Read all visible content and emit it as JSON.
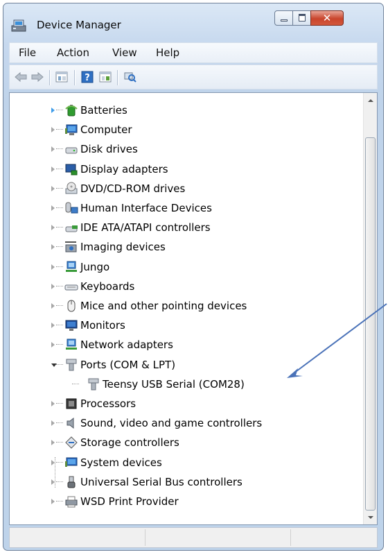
{
  "window": {
    "title": "Device Manager"
  },
  "menu": [
    "File",
    "Action",
    "View",
    "Help"
  ],
  "toolbar": {
    "buttons": [
      "back-icon",
      "forward-icon",
      "properties-icon",
      "help-icon",
      "show-hidden-icon",
      "scan-hardware-icon"
    ]
  },
  "tree": {
    "items": [
      {
        "label": "Batteries",
        "icon": "battery-icon",
        "state": "collapsed-hover"
      },
      {
        "label": "Computer",
        "icon": "computer-icon",
        "state": "collapsed"
      },
      {
        "label": "Disk drives",
        "icon": "disk-drive-icon",
        "state": "collapsed"
      },
      {
        "label": "Display adapters",
        "icon": "display-adapter-icon",
        "state": "collapsed"
      },
      {
        "label": "DVD/CD-ROM drives",
        "icon": "dvd-drive-icon",
        "state": "collapsed"
      },
      {
        "label": "Human Interface Devices",
        "icon": "hid-icon",
        "state": "collapsed"
      },
      {
        "label": "IDE ATA/ATAPI controllers",
        "icon": "ide-controller-icon",
        "state": "collapsed"
      },
      {
        "label": "Imaging devices",
        "icon": "camera-icon",
        "state": "collapsed"
      },
      {
        "label": "Jungo",
        "icon": "network-device-icon",
        "state": "collapsed"
      },
      {
        "label": "Keyboards",
        "icon": "keyboard-icon",
        "state": "collapsed"
      },
      {
        "label": "Mice and other pointing devices",
        "icon": "mouse-icon",
        "state": "collapsed"
      },
      {
        "label": "Monitors",
        "icon": "monitor-icon",
        "state": "collapsed"
      },
      {
        "label": "Network adapters",
        "icon": "network-adapter-icon",
        "state": "collapsed"
      },
      {
        "label": "Ports (COM & LPT)",
        "icon": "port-icon",
        "state": "expanded"
      },
      {
        "label": "Teensy USB Serial (COM28)",
        "icon": "port-icon",
        "state": "child"
      },
      {
        "label": "Processors",
        "icon": "processor-icon",
        "state": "collapsed"
      },
      {
        "label": "Sound, video and game controllers",
        "icon": "speaker-icon",
        "state": "collapsed"
      },
      {
        "label": "Storage controllers",
        "icon": "storage-controller-icon",
        "state": "collapsed"
      },
      {
        "label": "System devices",
        "icon": "system-devices-icon",
        "state": "collapsed"
      },
      {
        "label": "Universal Serial Bus controllers",
        "icon": "usb-icon",
        "state": "collapsed"
      },
      {
        "label": "WSD Print Provider",
        "icon": "printer-icon",
        "state": "collapsed"
      }
    ]
  },
  "colors": {
    "annotation_arrow": "#4a72b8",
    "hover_arrow": "#3f9de9"
  }
}
